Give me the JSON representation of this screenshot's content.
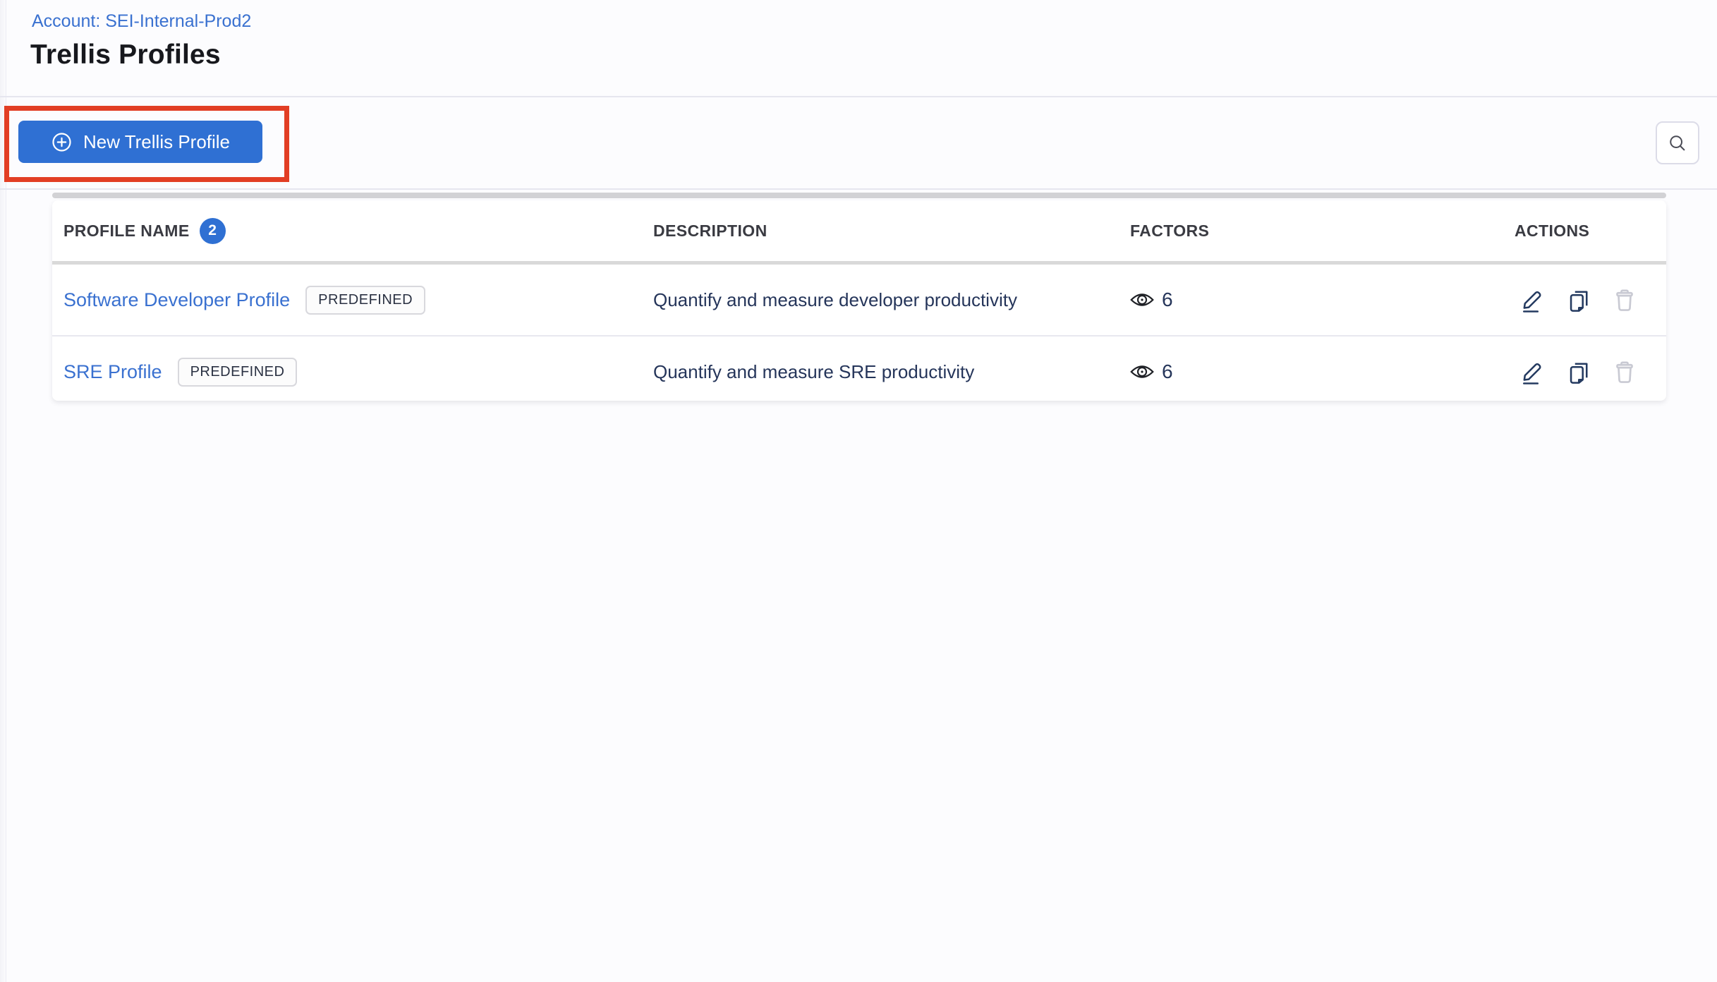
{
  "colors": {
    "page_bg": "#fcfcfe",
    "accent_blue": "#2f70d3",
    "link_blue": "#3a71d0",
    "annotation_red": "#e23e24",
    "text_dark": "#17181d",
    "text_navy": "#25355a",
    "header_gray": "#3a3b42",
    "disabled_gray": "#c9cad3"
  },
  "header": {
    "account_link": "Account: SEI-Internal-Prod2",
    "title": "Trellis Profiles"
  },
  "toolbar": {
    "new_profile_label": "New Trellis Profile",
    "icons": {
      "plus": "circle-plus-icon",
      "search": "search-icon"
    }
  },
  "annotation": {
    "type": "red-highlight-rectangle",
    "target": "New Trellis Profile button"
  },
  "table": {
    "headers": {
      "profile_name": "PROFILE NAME",
      "profile_count": "2",
      "description": "DESCRIPTION",
      "factors": "FACTORS",
      "actions": "ACTIONS"
    },
    "row_icons": {
      "factors": "eye-icon",
      "edit": "pencil-icon",
      "clone": "copy-icon",
      "delete": "trash-icon"
    },
    "rows": [
      {
        "name": "Software Developer Profile",
        "tag": "PREDEFINED",
        "description": "Quantify and measure developer productivity",
        "factors": "6"
      },
      {
        "name": "SRE Profile",
        "tag": "PREDEFINED",
        "description": "Quantify and measure SRE productivity",
        "factors": "6"
      }
    ]
  }
}
